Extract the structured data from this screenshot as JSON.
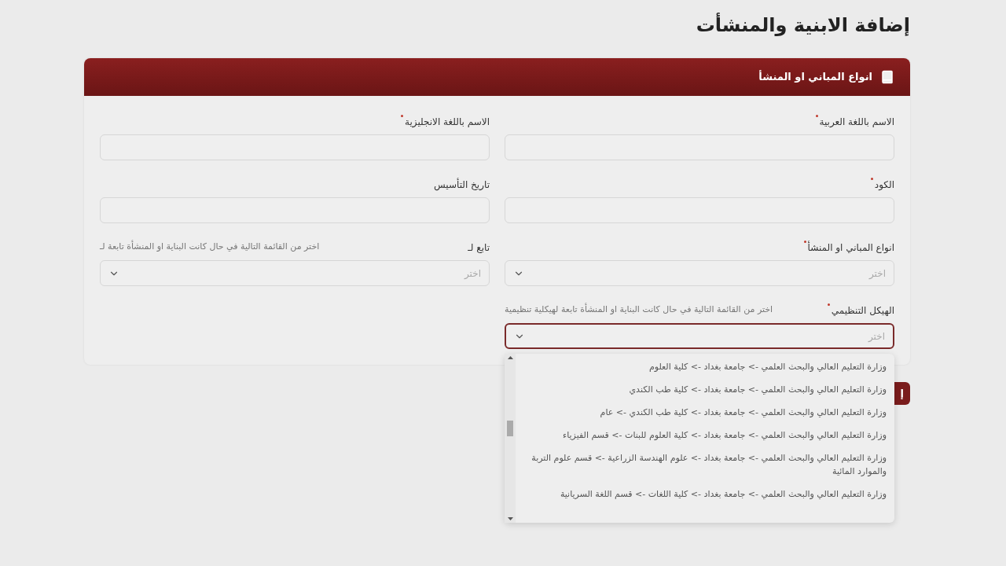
{
  "page_title": "إضافة الابنية والمنشأت",
  "card": {
    "title": "انواع المباني او المنشأ"
  },
  "fields": [
    {
      "kind": "text",
      "label": "الاسم باللغة العربية",
      "required": true
    },
    {
      "kind": "text",
      "label": "الاسم باللغة الانجليزية",
      "required": true
    },
    {
      "kind": "text",
      "label": "الكود",
      "required": true
    },
    {
      "kind": "text",
      "label": "تاريخ التأسيس",
      "required": false
    },
    {
      "kind": "select",
      "label": "انواع المباني او المنشأ",
      "required": true,
      "placeholder": "اختر",
      "focused": false
    },
    {
      "kind": "select",
      "label": "تابع لـ",
      "hint": "اختر من القائمة التالية في حال كانت البناية او المنشأة تابعة لـ",
      "required": false,
      "placeholder": "اختر",
      "focused": false
    },
    {
      "kind": "select",
      "label": "الهيكل التنظيمي",
      "hint": "اختر من القائمة التالية في حال كانت البناية او المنشأة تابعة لهيكلية تنظيمية",
      "required": true,
      "placeholder": "اختر",
      "focused": true,
      "expanded": true,
      "options": [
        "وزارة التعليم العالي والبحث العلمي -> جامعة بغداد -> كلية العلوم",
        "وزارة التعليم العالي والبحث العلمي -> جامعة بغداد -> كلية طب الكندي",
        "وزارة التعليم العالي والبحث العلمي -> جامعة بغداد -> كلية طب الكندي -> عام",
        "وزارة التعليم العالي والبحث العلمي -> جامعة بغداد -> كلية العلوم للبنات -> قسم الفيزياء",
        "وزارة التعليم العالي والبحث العلمي -> جامعة بغداد -> علوم الهندسة الزراعية -> قسم علوم التربة والموارد المائية",
        "وزارة التعليم العالي والبحث العلمي -> جامعة بغداد -> كلية اللغات -> قسم اللغة السريانية"
      ]
    }
  ],
  "submit_button": "إ"
}
